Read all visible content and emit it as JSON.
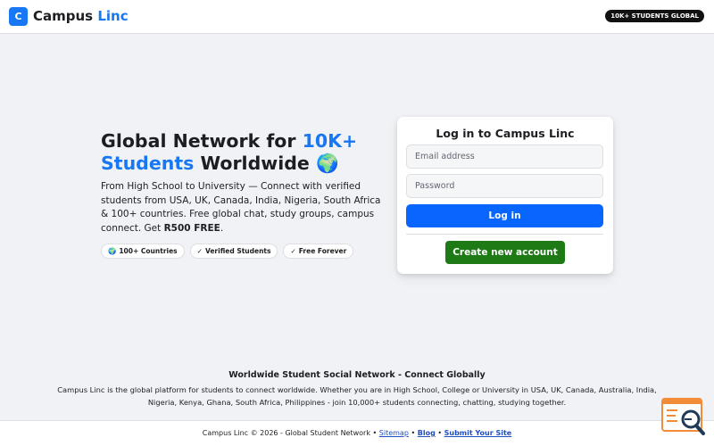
{
  "header": {
    "logo_letter": "C",
    "brand_first": "Campus",
    "brand_second": "Linc",
    "badge": "10K+ STUDENTS GLOBAL"
  },
  "hero": {
    "title_part1": "Global Network for ",
    "title_accent": "10K+ Students",
    "title_part2": " Worldwide ",
    "title_emoji": "🌍",
    "description_main": "From High School to University — Connect with verified students from USA, UK, Canada, India, Nigeria, South Africa & 100+ countries. Free global chat, study groups, campus connect. Get ",
    "description_bold": "R500 FREE",
    "description_end": ".",
    "pills": [
      {
        "icon": "🌍",
        "label": "100+ Countries"
      },
      {
        "icon": "✓",
        "label": "Verified Students"
      },
      {
        "icon": "✓",
        "label": "Free Forever"
      }
    ]
  },
  "login": {
    "title": "Log in to Campus Linc",
    "email_placeholder": "Email address",
    "password_placeholder": "Password",
    "login_label": "Log in",
    "create_label": "Create new account"
  },
  "info": {
    "title": "Worldwide Student Social Network - Connect Globally",
    "text": "Campus Linc is the global platform for students to connect worldwide. Whether you are in High School, College or University in USA, UK, Canada, Australia, India, Nigeria, Kenya, Ghana, South Africa, Philippines - join 10,000+ students connecting, chatting, studying together."
  },
  "footer": {
    "copyright": "Campus Linc © 2026 - Global Student Network • ",
    "sitemap": "Sitemap",
    "sep1": " • ",
    "blog": "Blog",
    "sep2": " • ",
    "submit": "Submit Your Site"
  },
  "colors": {
    "accent": "#1877f2",
    "login_button": "#0866ff",
    "create_button": "#1d7a14",
    "background": "#f0f2f5"
  },
  "icons": {
    "widget": "search-doc-widget-icon"
  }
}
